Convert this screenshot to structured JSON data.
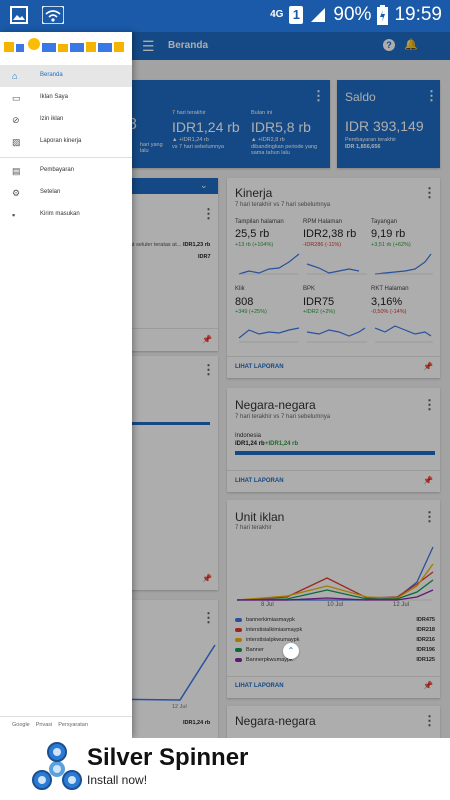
{
  "status_bar": {
    "network": "4G",
    "sim": "1",
    "battery": "90%",
    "time": "19:59"
  },
  "app_bar": {
    "title": "Beranda"
  },
  "drawer": {
    "items": [
      {
        "label": "Beranda",
        "icon": "home-icon"
      },
      {
        "label": "Iklan Saya",
        "icon": "ads-icon"
      },
      {
        "label": "Izin iklan",
        "icon": "block-icon"
      },
      {
        "label": "Laporan kinerja",
        "icon": "report-icon"
      },
      {
        "label": "Pembayaran",
        "icon": "payment-icon"
      },
      {
        "label": "Setelan",
        "icon": "gear-icon"
      },
      {
        "label": "Kirim masukan",
        "icon": "feedback-icon"
      }
    ],
    "footer": {
      "google": "Google",
      "privacy": "Privasi",
      "terms": "Persyaratan"
    }
  },
  "earnings_card": {
    "c1_value": "8",
    "c1_note": "hari yang\nlalu",
    "c2_period": "7 hari terakhir",
    "c2_value": "IDR1,24 rb",
    "c2_change": "▲ +IDR1,24 rb",
    "c2_note": "vs 7 hari sebelumnya",
    "c3_period": "Bulan ini",
    "c3_value": "IDR5,8 rb",
    "c3_change": "▲ +IDR2,8 rb",
    "c3_note": "dibandingkan periode yang sama tahun lalu"
  },
  "saldo_card": {
    "title": "Saldo",
    "value": "IDR 393,149",
    "note": "Pembayaran terakhir",
    "last_payment": "IDR 1,856,656"
  },
  "left_card1": {
    "text": "at seluler teratas at...",
    "value1": "IDR1,23 rb",
    "value2": "IDR7"
  },
  "left_card3": {
    "x_label": "12 Jul",
    "value": "IDR1,24 rb"
  },
  "kinerja": {
    "title": "Kinerja",
    "period": "7 hari terakhir vs 7 hari sebelumnya",
    "metrics": [
      {
        "label": "Tampilan halaman",
        "value": "25,5 rb",
        "change": "+13 rb (+104%)",
        "dir": "up"
      },
      {
        "label": "RPM Halaman",
        "value": "IDR2,38 rb",
        "change": "-IDR286 (-11%)",
        "dir": "down"
      },
      {
        "label": "Tayangan",
        "value": "9,19 rb",
        "change": "+3,51 rb (+62%)",
        "dir": "up"
      },
      {
        "label": "Klik",
        "value": "808",
        "change": "+349 (+25%)",
        "dir": "up"
      },
      {
        "label": "BPK",
        "value": "IDR75",
        "change": "+IDR2 (+2%)",
        "dir": "up"
      },
      {
        "label": "RKT Halaman",
        "value": "3,16%",
        "change": "-0,50% (-14%)",
        "dir": "down"
      }
    ],
    "link": "LIHAT LAPORAN"
  },
  "negara1": {
    "title": "Negara-negara",
    "period": "7 hari terakhir vs 7 hari sebelumnya",
    "country": "Indonesia",
    "value": "IDR1,24 rb",
    "change": "+IDR1,24 rb",
    "bar_fraction": 1.0,
    "link": "LIHAT LAPORAN"
  },
  "unit_iklan": {
    "title": "Unit iklan",
    "period": "7 hari terakhir",
    "x_ticks": [
      "8 Jul",
      "10 Jul",
      "12 Jul"
    ],
    "legend": [
      {
        "name": "bannerkimiasmaypk",
        "value": "IDR475",
        "color": "#3b78e7"
      },
      {
        "name": "interstisialkimiasmaypk",
        "value": "IDR218",
        "color": "#e53935"
      },
      {
        "name": "interstisialpkwumaypk",
        "value": "IDR216",
        "color": "#f4b400"
      },
      {
        "name": "Banner",
        "value": "IDR196",
        "color": "#0f9d58"
      },
      {
        "name": "Bannerpkwumaypk",
        "value": "IDR125",
        "color": "#8e24aa"
      }
    ],
    "link": "LIHAT LAPORAN"
  },
  "negara2": {
    "title": "Negara-negara"
  },
  "ad_banner": {
    "name": "Silver Spinner",
    "cta": "Install now!"
  },
  "colors": {
    "primary": "#1e6cc6",
    "statusbar": "#1a5aa8"
  }
}
